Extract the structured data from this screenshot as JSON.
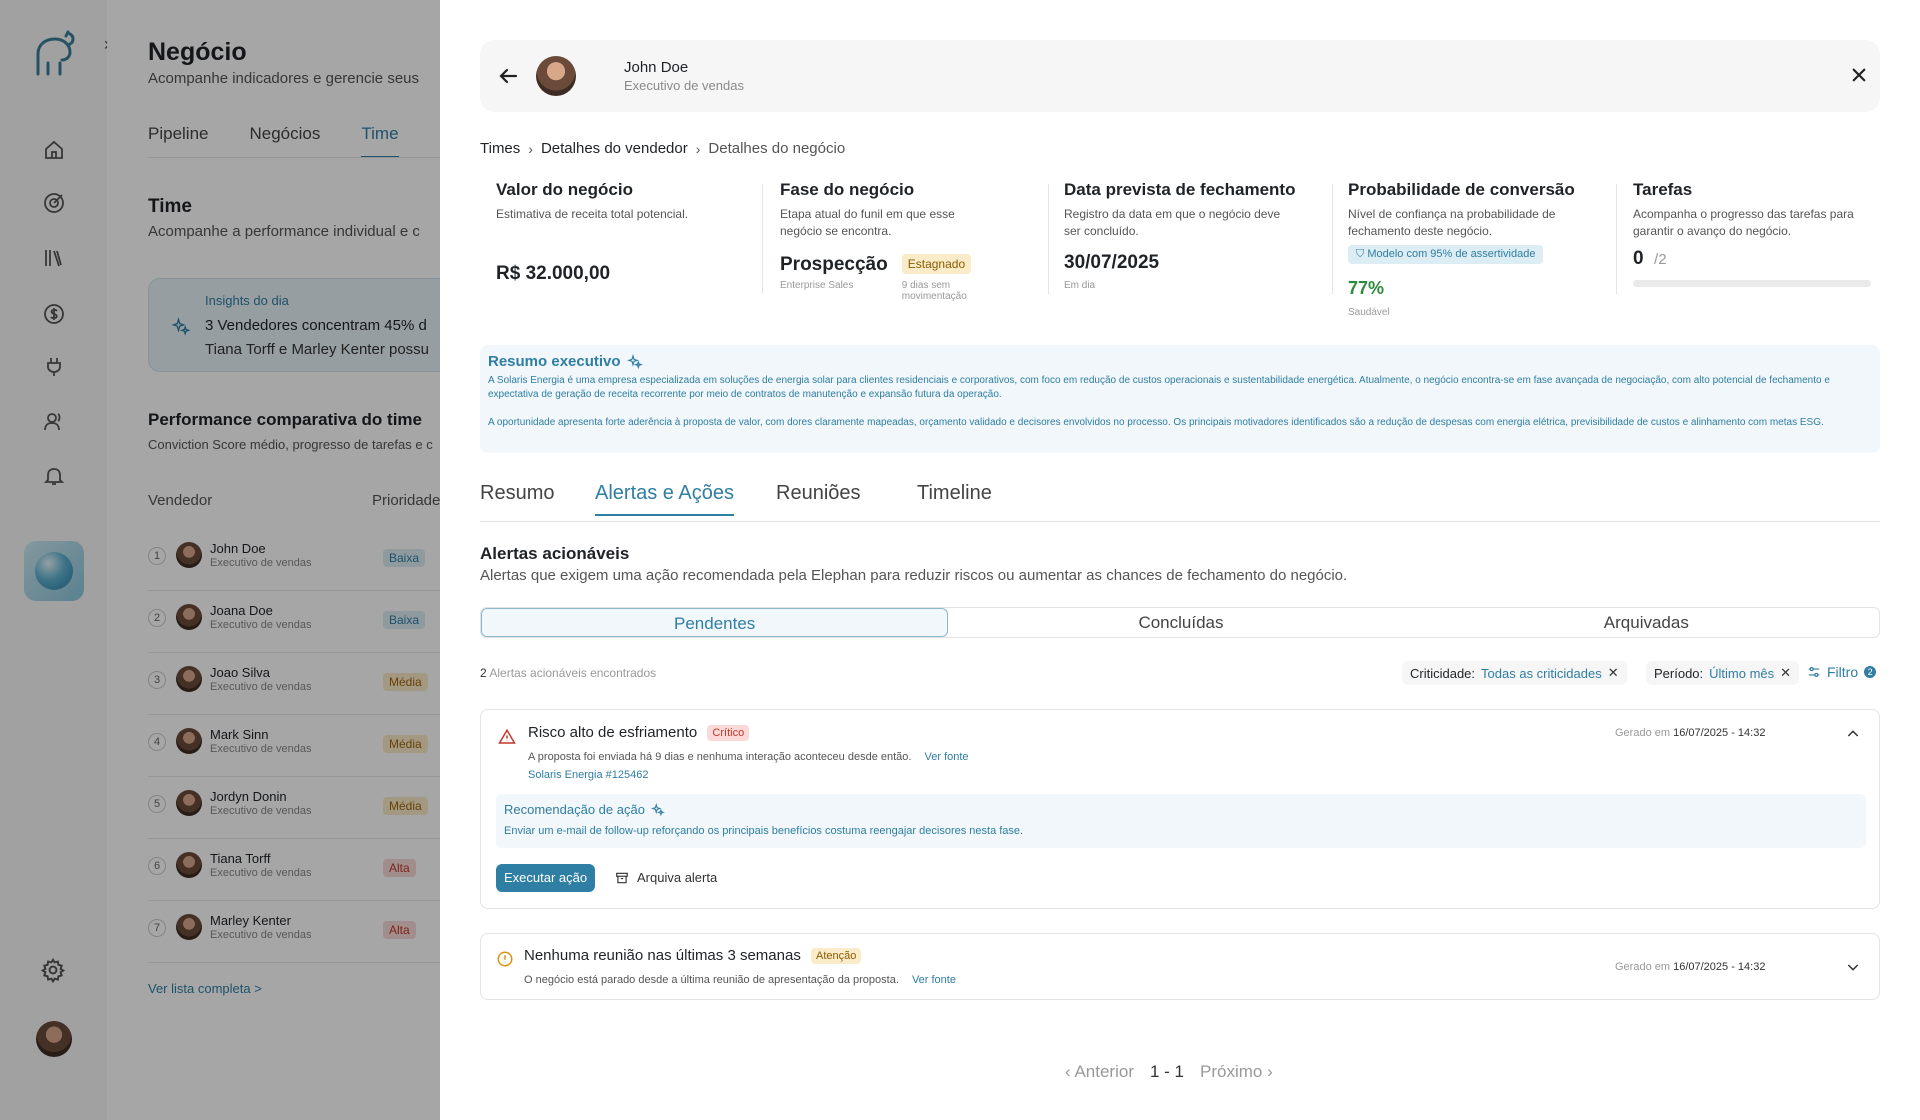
{
  "background": {
    "title": "Negócio",
    "subtitle": "Acompanhe indicadores e gerencie seus",
    "tabs": [
      "Pipeline",
      "Negócios",
      "Time"
    ],
    "section_title": "Time",
    "section_subtitle": "Acompanhe a performance individual e c",
    "insight": {
      "kicker": "Insights do dia",
      "line1": "3 Vendedores concentram 45% d",
      "line2": "Tiana Torff e  Marley Kenter possu"
    },
    "performance_title": "Performance comparativa do time",
    "performance_subtitle": "Conviction Score médio, progresso de tarefas e c",
    "columns": [
      "Vendedor",
      "Prioridade"
    ],
    "sellers": [
      {
        "n": "1",
        "name": "John Doe",
        "role": "Executivo de vendas",
        "priority": "Baixa",
        "level": "baixa"
      },
      {
        "n": "2",
        "name": "Joana Doe",
        "role": "Executivo de vendas",
        "priority": "Baixa",
        "level": "baixa"
      },
      {
        "n": "3",
        "name": "Joao Silva",
        "role": "Executivo de vendas",
        "priority": "Média",
        "level": "media"
      },
      {
        "n": "4",
        "name": "Mark Sinn",
        "role": "Executivo de vendas",
        "priority": "Média",
        "level": "media"
      },
      {
        "n": "5",
        "name": "Jordyn Donin",
        "role": "Executivo de vendas",
        "priority": "Média",
        "level": "media"
      },
      {
        "n": "6",
        "name": "Tiana Torff",
        "role": "Executivo de vendas",
        "priority": "Alta",
        "level": "alta"
      },
      {
        "n": "7",
        "name": "Marley Kenter",
        "role": "Executivo de vendas",
        "priority": "Alta",
        "level": "alta"
      }
    ],
    "full_list_link": "Ver lista completa >"
  },
  "drawer": {
    "user": {
      "name": "John Doe",
      "role": "Executivo de vendas"
    },
    "breadcrumb": [
      "Times",
      "Detalhes do vendedor",
      "Detalhes do negócio"
    ],
    "kpis": {
      "valor": {
        "title": "Valor do negócio",
        "desc": "Estimativa de receita total potencial.",
        "value": "R$ 32.000,00"
      },
      "fase": {
        "title": "Fase do negócio",
        "desc": "Etapa atual do funil  em que esse negócio se encontra.",
        "value": "Prospecção",
        "sub": "Enterprise Sales",
        "tag": "Estagnado",
        "tag_sub": "9 dias sem movimentação"
      },
      "data": {
        "title": "Data prevista de fechamento",
        "desc": "Registro da data em que o negócio deve ser concluído.",
        "value": "30/07/2025",
        "sub": "Em dia"
      },
      "prob": {
        "title": "Probabilidade de conversão",
        "desc": "Nível de confiança na probabilidade de fechamento deste negócio.",
        "badge": "Modelo com 95% de assertividade",
        "value": "77%",
        "sub": "Saudável"
      },
      "tarefas": {
        "title": "Tarefas",
        "desc": "Acompanha o progresso das tarefas para garantir o avanço do negócio.",
        "done": "0",
        "total": "/2",
        "progress": 0
      }
    },
    "resumo": {
      "title": "Resumo executivo",
      "p1": "A Solaris Energia é uma empresa especializada em soluções de energia solar para clientes residenciais e corporativos, com foco em redução de custos operacionais e sustentabilidade energética. Atualmente, o negócio encontra-se em fase avançada de negociação, com alto potencial de fechamento e expectativa de geração de receita recorrente por meio de contratos de manutenção e expansão futura da operação.",
      "p2": "A oportunidade apresenta forte aderência à proposta de valor, com dores claramente mapeadas, orçamento validado e decisores envolvidos no processo. Os principais motivadores identificados são a redução de despesas com energia elétrica, previsibilidade de custos e alinhamento com metas ESG."
    },
    "tabs": [
      "Resumo",
      "Alertas e Ações",
      "Reuniões",
      "Timeline"
    ],
    "alerts_title": "Alertas acionáveis",
    "alerts_subtitle": "Alertas que exigem uma ação recomendada pela Elephan para reduzir riscos ou aumentar as chances de fechamento do negócio.",
    "segments": [
      "Pendentes",
      "Concluídas",
      "Arquivadas"
    ],
    "found_count": "2",
    "found_label": "Alertas acionáveis encontrados",
    "filters": {
      "crit_label": "Criticidade:",
      "crit_value": "Todas as criticidades",
      "period_label": "Período:",
      "period_value": "Último mês",
      "filter_label": "Filtro",
      "filter_count": "2"
    },
    "alert1": {
      "title": "Risco alto de esfriamento",
      "tag": "Crítico",
      "desc": "A proposta foi enviada há 9 dias e nenhuma interação aconteceu desde então.",
      "source_link": "Ver fonte",
      "source": "Solaris Energia #125462",
      "generated_label": "Gerado em",
      "generated_at": "16/07/2025 - 14:32",
      "rec_title": "Recomendação de ação",
      "rec_desc": "Enviar um e-mail de follow-up reforçando os principais benefícios costuma reengajar decisores nesta fase.",
      "execute": "Executar ação",
      "archive": "Arquiva alerta"
    },
    "alert2": {
      "title": "Nenhuma reunião nas últimas 3 semanas",
      "tag": "Atenção",
      "desc": "O negócio está parado desde a última reunião de apresentação da proposta.",
      "source_link": "Ver fonte",
      "generated_label": "Gerado em",
      "generated_at": "16/07/2025 - 14:32"
    },
    "pager": {
      "prev": "Anterior",
      "range": "1 - 1",
      "next": "Próximo"
    }
  }
}
